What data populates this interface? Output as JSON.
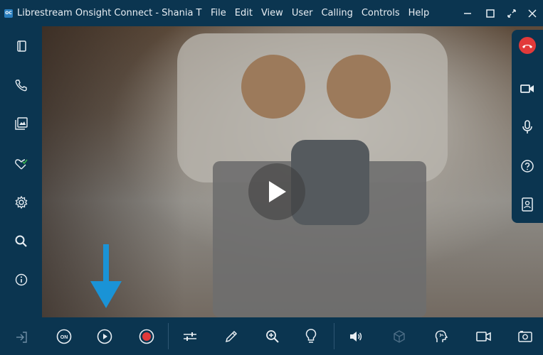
{
  "window": {
    "title": "Librestream Onsight Connect - Shania T",
    "app_icon_text": "OC"
  },
  "menu": {
    "items": [
      "File",
      "Edit",
      "View",
      "User",
      "Calling",
      "Controls",
      "Help"
    ]
  },
  "window_controls": [
    "minimize",
    "maximize",
    "fullscreen",
    "close"
  ],
  "sidebar": {
    "items": [
      {
        "name": "panel-icon"
      },
      {
        "name": "phone-icon"
      },
      {
        "name": "gallery-icon"
      },
      {
        "name": "heart-check-icon"
      },
      {
        "name": "settings-icon"
      },
      {
        "name": "search-icon"
      },
      {
        "name": "info-icon"
      },
      {
        "name": "exit-icon"
      }
    ]
  },
  "right_toolbar": {
    "items": [
      "end-call-icon",
      "video-camera-icon",
      "microphone-icon",
      "help-icon",
      "contact-card-icon"
    ],
    "end_call_color": "#e23a3a"
  },
  "bottom_toolbar": {
    "on_label": "ON",
    "items": [
      "on-toggle-icon",
      "play-icon",
      "record-icon",
      "sliders-icon",
      "pen-icon",
      "zoom-in-icon",
      "light-bulb-icon",
      "speaker-icon",
      "3d-cube-icon",
      "telestration-icon",
      "camera-icon",
      "snapshot-icon"
    ],
    "record_color": "#e23a3a",
    "arrow_color": "#1a93d6"
  }
}
